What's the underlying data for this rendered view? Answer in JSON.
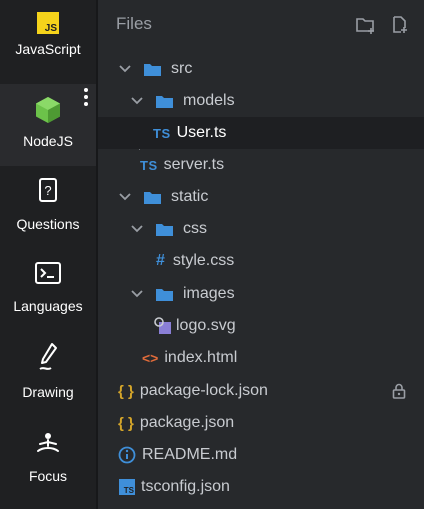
{
  "sidebar": {
    "items": [
      {
        "label": "JavaScript",
        "icon": "js-logo-icon",
        "badge": "JS"
      },
      {
        "label": "NodeJS",
        "icon": "nodejs-hexagon-icon",
        "active": true
      },
      {
        "label": "Questions",
        "icon": "question-icon"
      },
      {
        "label": "Languages",
        "icon": "terminal-icon"
      },
      {
        "label": "Drawing",
        "icon": "pen-icon"
      },
      {
        "label": "Focus",
        "icon": "meditation-icon"
      }
    ]
  },
  "panel": {
    "title": "Files",
    "header_icons": [
      "new-folder-icon",
      "new-file-icon"
    ]
  },
  "tree": [
    {
      "name": "src",
      "type": "folder",
      "expanded": true
    },
    {
      "name": "models",
      "type": "folder",
      "expanded": true
    },
    {
      "name": "User.ts",
      "type": "ts",
      "badge": "TS",
      "selected": true
    },
    {
      "name": "server.ts",
      "type": "ts",
      "badge": "TS"
    },
    {
      "name": "static",
      "type": "folder",
      "expanded": true
    },
    {
      "name": "css",
      "type": "folder",
      "expanded": true
    },
    {
      "name": "style.css",
      "type": "css",
      "badge": "#"
    },
    {
      "name": "images",
      "type": "folder",
      "expanded": true
    },
    {
      "name": "logo.svg",
      "type": "svg"
    },
    {
      "name": "index.html",
      "type": "html",
      "badge": "<>"
    },
    {
      "name": "package-lock.json",
      "type": "json",
      "badge": "{ }",
      "locked": true
    },
    {
      "name": "package.json",
      "type": "json",
      "badge": "{ }"
    },
    {
      "name": "README.md",
      "type": "md"
    },
    {
      "name": "tsconfig.json",
      "type": "tsconfig",
      "badge": "TS"
    }
  ],
  "colors": {
    "accent_folder": "#3f8fd9",
    "js_yellow": "#f5d31b",
    "node_green": "#6cc24a",
    "json_yellow": "#d4a52a",
    "html_orange": "#e06b3a",
    "svg_purple": "#8a7fd6"
  }
}
